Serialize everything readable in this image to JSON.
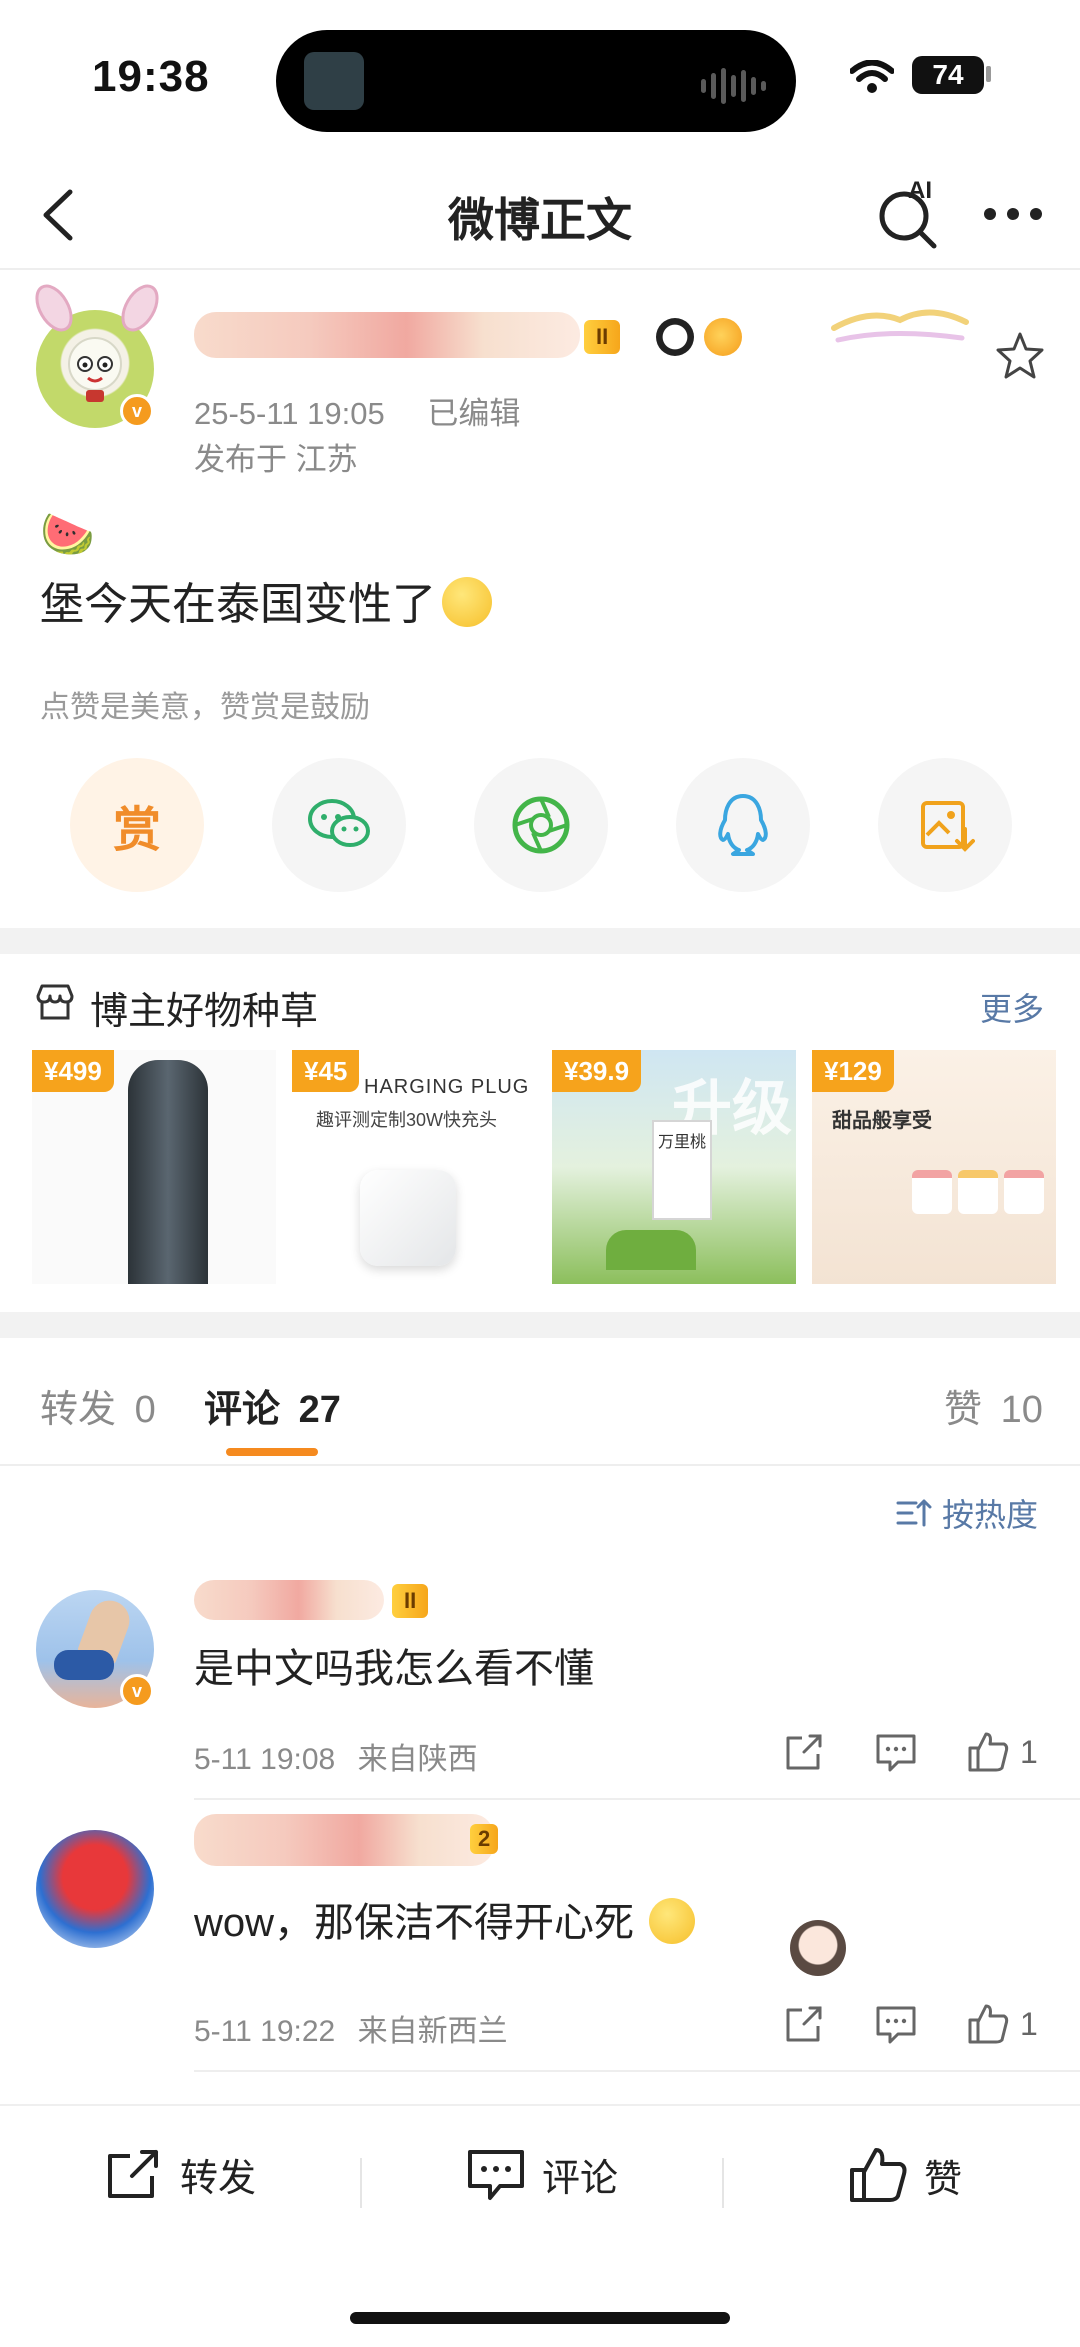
{
  "status_bar": {
    "time": "19:38",
    "battery": "74"
  },
  "nav": {
    "title": "微博正文",
    "ai_label": "AI"
  },
  "post": {
    "timestamp": "25-5-11 19:05",
    "edited": "已编辑",
    "location": "发布于 江苏",
    "level_badge": "II",
    "lead_emoji": "🍉",
    "text": "堡今天在泰国变性了",
    "hint": "点赞是美意，赞赏是鼓励",
    "reward_label": "赏"
  },
  "goods": {
    "title": "博主好物种草",
    "more": "更多",
    "items": [
      {
        "price": "¥499",
        "caption": ""
      },
      {
        "price": "¥45",
        "caption": "HARGING PLUG",
        "sub": "趣评测定制30W快充头"
      },
      {
        "price": "¥39.9",
        "caption": "万里桃"
      },
      {
        "price": "¥129",
        "caption": "甜品般享受"
      }
    ]
  },
  "tabs": {
    "repost_label": "转发",
    "repost_count": "0",
    "comment_label": "评论",
    "comment_count": "27",
    "like_label": "赞",
    "like_count": "10"
  },
  "sort_label": "按热度",
  "comments": [
    {
      "badge": "II",
      "text": "是中文吗我怎么看不懂",
      "time": "5-11 19:08",
      "source": "来自陕西",
      "likes": "1"
    },
    {
      "badge": "2",
      "text": "wow，那保洁不得开心死",
      "time": "5-11 19:22",
      "source": "来自新西兰",
      "likes": "1"
    }
  ],
  "bottom_bar": {
    "repost": "转发",
    "comment": "评论",
    "like": "赞"
  },
  "colors": {
    "accent": "#f58a1f",
    "link": "#5879a6",
    "badge": "#f6a31c"
  }
}
